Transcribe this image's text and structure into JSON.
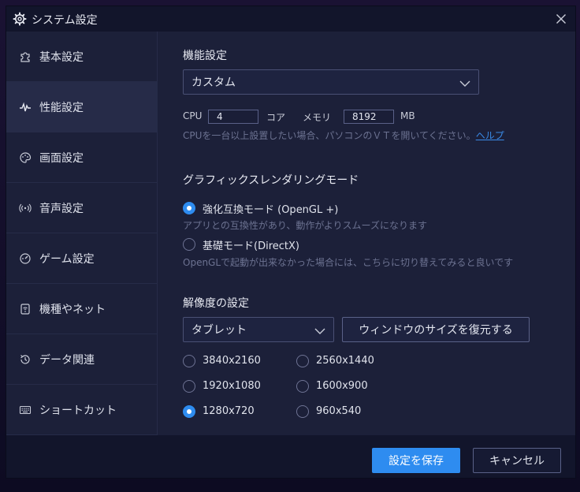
{
  "window": {
    "title": "システム設定",
    "title_icon": "gear-icon",
    "close_icon": "close-icon"
  },
  "sidebar": {
    "items": [
      {
        "label": "基本設定",
        "icon": "puzzle-icon",
        "active": false
      },
      {
        "label": "性能設定",
        "icon": "pulse-icon",
        "active": true
      },
      {
        "label": "画面設定",
        "icon": "palette-icon",
        "active": false
      },
      {
        "label": "音声設定",
        "icon": "speaker-icon",
        "active": false
      },
      {
        "label": "ゲーム設定",
        "icon": "gamepad-icon",
        "active": false
      },
      {
        "label": "機種やネット",
        "icon": "device-icon",
        "active": false
      },
      {
        "label": "データ関連",
        "icon": "history-icon",
        "active": false
      },
      {
        "label": "ショートカット",
        "icon": "keyboard-icon",
        "active": false
      }
    ]
  },
  "performance": {
    "section_title": "機能設定",
    "preset_value": "カスタム",
    "cpu_label": "CPU",
    "cpu_value": "4",
    "core_label": "コア",
    "memory_label": "メモリ",
    "memory_value": "8192",
    "mb_label": "MB",
    "hint_text": "CPUを一台以上設置したい場合、パソコンのＶＴを開いてください。",
    "help_link": "ヘルプ"
  },
  "graphics": {
    "section_title": "グラフィックスレンダリングモード",
    "options": [
      {
        "label": "強化互換モード (OpenGL +)",
        "description": "アプリとの互換性があり、動作がよりスムーズになります",
        "selected": true
      },
      {
        "label": "基礎モード(DirectX)",
        "description": "OpenGLで起動が出来なかった場合には、こちらに切り替えてみると良いです",
        "selected": false
      }
    ]
  },
  "resolution": {
    "section_title": "解像度の設定",
    "mode_value": "タブレット",
    "restore_button": "ウィンドウのサイズを復元する",
    "options": [
      {
        "label": "3840x2160",
        "selected": false
      },
      {
        "label": "2560x1440",
        "selected": false
      },
      {
        "label": "1920x1080",
        "selected": false
      },
      {
        "label": "1600x900",
        "selected": false
      },
      {
        "label": "1280x720",
        "selected": true
      },
      {
        "label": "960x540",
        "selected": false
      }
    ]
  },
  "footer": {
    "save_button": "設定を保存",
    "cancel_button": "キャンセル"
  },
  "colors": {
    "accent": "#2e8cf0",
    "panel": "#1c2039",
    "link": "#3a8be8"
  }
}
